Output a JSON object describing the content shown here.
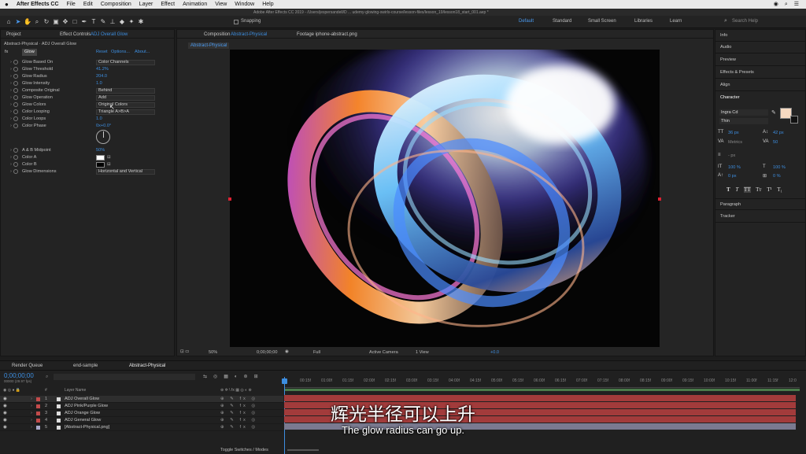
{
  "menubar": {
    "apple": "",
    "items": [
      "After Effects CC",
      "File",
      "Edit",
      "Composition",
      "Layer",
      "Effect",
      "Animation",
      "View",
      "Window",
      "Help"
    ]
  },
  "titlebar": {
    "title": "Adobe After Effects CC 2019 - /Users/jespersandell/D ... udemy-glowing-swirls-course/lesson-files/lesson_19/lesson18_start_001.aep *"
  },
  "toolbar": {
    "snapping": "Snapping",
    "workspaces": [
      "Default",
      "Standard",
      "Small Screen",
      "Libraries",
      "Learn"
    ],
    "search_placeholder": "Search Help"
  },
  "left_panel": {
    "tab_project": "Project",
    "tab_effect": "Effect Controls",
    "tab_effect_target": "ADJ Overall Glow",
    "breadcrumb": "Abstract-Physical · ADJ Overall Glow",
    "effect_name": "Glow",
    "reset": "Reset",
    "options": "Options...",
    "about": "About...",
    "props": [
      {
        "name": "Glow Based On",
        "value": "Color Channels",
        "kind": "dd"
      },
      {
        "name": "Glow Threshold",
        "value": "41.2%",
        "kind": "val"
      },
      {
        "name": "Glow Radius",
        "value": "204.0",
        "kind": "val"
      },
      {
        "name": "Glow Intensity",
        "value": "1.0",
        "kind": "val"
      },
      {
        "name": "Composite Original",
        "value": "Behind",
        "kind": "dd"
      },
      {
        "name": "Glow Operation",
        "value": "Add",
        "kind": "dd"
      },
      {
        "name": "Glow Colors",
        "value": "Original Colors",
        "kind": "dd"
      },
      {
        "name": "Color Looping",
        "value": "Triangle A>B>A",
        "kind": "dd"
      },
      {
        "name": "Color Loops",
        "value": "1.0",
        "kind": "val"
      },
      {
        "name": "Color Phase",
        "value": "0x+0.0°",
        "kind": "val"
      },
      {
        "name": "A & B Midpoint",
        "value": "50%",
        "kind": "val"
      },
      {
        "name": "Color A",
        "value": "",
        "kind": "swatch-white"
      },
      {
        "name": "Color B",
        "value": "",
        "kind": "swatch-black"
      },
      {
        "name": "Glow Dimensions",
        "value": "Horizontal and Vertical",
        "kind": "dd"
      }
    ]
  },
  "comp_panel": {
    "tab_comp": "Composition",
    "tab_comp_name": "Abstract-Physical",
    "tab_footage": "Footage iphone-abstract.png",
    "subtab": "Abstract-Physical",
    "zoom": "50%",
    "timecode": "0;00;00;00",
    "resolution": "Full",
    "camera": "Active Camera",
    "view": "1 View",
    "exposure": "+0.0"
  },
  "right_panel": {
    "items": [
      "Info",
      "Audio",
      "Preview",
      "Effects & Presets",
      "Align"
    ],
    "character_title": "Character",
    "font": "Ingra Cd",
    "style": "Thin",
    "size": "36 px",
    "leading": "42 px",
    "kerning": "Metrics",
    "tracking": "50",
    "stroke": "- px",
    "vscale": "100 %",
    "hscale": "100 %",
    "baseline": "0 px",
    "tsume": "0 %",
    "text_styles": [
      "T",
      "T",
      "TT",
      "Tт",
      "T¹",
      "T₁"
    ],
    "paragraph": "Paragraph",
    "tracker": "Tracker"
  },
  "timeline": {
    "tabs": [
      "Render Queue",
      "end-sample",
      "Abstract-Physical"
    ],
    "timecode": "0;00;00;00",
    "fps": "00000 (29.97 fps)",
    "col_layer_name": "Layer Name",
    "layers": [
      {
        "num": "1",
        "name": "ADJ Overall Glow",
        "color": "#c24b4b"
      },
      {
        "num": "2",
        "name": "ADJ Pink/Purple Glow",
        "color": "#c24b4b"
      },
      {
        "num": "3",
        "name": "ADJ Orange Glow",
        "color": "#c24b4b"
      },
      {
        "num": "4",
        "name": "ADJ General Glow",
        "color": "#c24b4b"
      },
      {
        "num": "5",
        "name": "[Abstract-Physical.png]",
        "color": "#a8a8c8"
      }
    ],
    "toggle": "Toggle Switches / Modes",
    "ticks": [
      "00:15f",
      "01:00f",
      "01:15f",
      "02:00f",
      "02:15f",
      "03:00f",
      "03:15f",
      "04:00f",
      "04:15f",
      "05:00f",
      "05:15f",
      "06:00f",
      "06:15f",
      "07:00f",
      "07:15f",
      "08:00f",
      "08:15f",
      "09:00f",
      "09:15f",
      "10:00f",
      "10:15f",
      "11:00f",
      "11:15f",
      "12:0"
    ]
  },
  "subtitles": {
    "zh": "辉光半径可以上升",
    "en": "The glow radius can go up."
  },
  "colors": {
    "accent": "#3d8ee0",
    "layer_bar": "#a23b3b",
    "layer_bar_last": "#7a7a90"
  }
}
